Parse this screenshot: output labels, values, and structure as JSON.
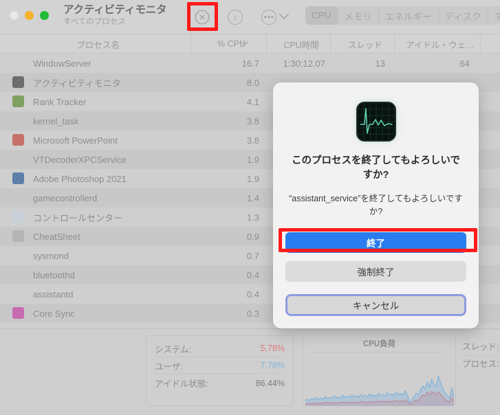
{
  "window": {
    "title": "アクティビティモニタ",
    "subtitle": "すべてのプロセス",
    "traffic": {
      "close": "close-button",
      "minimize": "minimize-button",
      "maximize": "maximize-button"
    }
  },
  "toolbar": {
    "quit_process_icon": "quit-process-octagon-icon",
    "info_icon": "info-circle-icon",
    "more_icon": "ellipsis-circle-icon",
    "chevron_icon": "chevron-down-icon",
    "highlight_color": "#ff1a1a",
    "tabs": [
      {
        "label": "CPU",
        "active": true
      },
      {
        "label": "メモリ",
        "active": false
      },
      {
        "label": "エネルギー",
        "active": false
      },
      {
        "label": "ディスク",
        "active": false
      },
      {
        "label": "ネッ",
        "active": false
      }
    ]
  },
  "table": {
    "columns": [
      {
        "label": "プロセス名"
      },
      {
        "label": "% CPU",
        "sort": "descending",
        "sort_icon": "chevron-down-icon"
      },
      {
        "label": "CPU時間"
      },
      {
        "label": "スレッド"
      },
      {
        "label": "アイドル・ウェ…"
      }
    ],
    "rows": [
      {
        "name": "WindowServer",
        "cpu": "16.7",
        "time": "1:30:12.07",
        "threads": "13",
        "idle": "64",
        "icon": ""
      },
      {
        "name": "アクティビティモニタ",
        "cpu": "8.0",
        "time": "",
        "threads": "",
        "idle": "",
        "icon": "#6d6d6d"
      },
      {
        "name": "Rank Tracker",
        "cpu": "4.1",
        "time": "",
        "threads": "",
        "idle": "",
        "icon": "#7fa05f"
      },
      {
        "name": "kernel_task",
        "cpu": "3.8",
        "time": "",
        "threads": "",
        "idle": "",
        "icon": ""
      },
      {
        "name": "Microsoft PowerPoint",
        "cpu": "3.8",
        "time": "",
        "threads": "",
        "idle": "",
        "icon": "#c8706a"
      },
      {
        "name": "VTDecoderXPCService",
        "cpu": "1.9",
        "time": "",
        "threads": "",
        "idle": "",
        "icon": ""
      },
      {
        "name": "Adobe Photoshop 2021",
        "cpu": "1.9",
        "time": "",
        "threads": "",
        "idle": "",
        "icon": "#5b7fa8"
      },
      {
        "name": "gamecontrollerd",
        "cpu": "1.4",
        "time": "",
        "threads": "",
        "idle": "",
        "icon": ""
      },
      {
        "name": "コントロールセンター",
        "cpu": "1.3",
        "time": "",
        "threads": "",
        "idle": "",
        "icon": "#c9cfd8"
      },
      {
        "name": "CheatSheet",
        "cpu": "0.9",
        "time": "",
        "threads": "",
        "idle": "",
        "icon": "#b4b4b4"
      },
      {
        "name": "sysmond",
        "cpu": "0.7",
        "time": "",
        "threads": "",
        "idle": "",
        "icon": ""
      },
      {
        "name": "bluetoothd",
        "cpu": "0.4",
        "time": "",
        "threads": "",
        "idle": "",
        "icon": ""
      },
      {
        "name": "assistantd",
        "cpu": "0.4",
        "time": "",
        "threads": "",
        "idle": "",
        "icon": ""
      },
      {
        "name": "Core Sync",
        "cpu": "0.3",
        "time": "",
        "threads": "",
        "idle": "",
        "icon": "#c86ab0"
      }
    ]
  },
  "footer": {
    "stats": [
      {
        "label": "システム:",
        "value": "5.78%",
        "color": "#e0787a"
      },
      {
        "label": "ユーザ:",
        "value": "7.78%",
        "color": "#7fb3dd"
      },
      {
        "label": "アイドル状態:",
        "value": "86.44%",
        "color": "#7d7d7d"
      }
    ],
    "graph_title": "CPU負荷",
    "right_labels": [
      {
        "label": "スレッド:"
      },
      {
        "label": "プロセス:"
      }
    ]
  },
  "dialog": {
    "app_icon": "activity-monitor-ekg-icon",
    "title": "このプロセスを終了してもよろしいですか?",
    "message": "“assistant_service”を終了してもよろしいですか?",
    "buttons": [
      {
        "label": "終了",
        "style": "primary",
        "highlighted": true
      },
      {
        "label": "強制終了",
        "style": "secondary",
        "highlighted": false
      },
      {
        "label": "キャンセル",
        "style": "focused",
        "highlighted": false
      }
    ]
  },
  "chart_data": {
    "type": "area",
    "title": "CPU負荷",
    "xlabel": "",
    "ylabel": "",
    "ylim": [
      0,
      100
    ],
    "series": [
      {
        "name": "ユーザ",
        "color": "#7fb3dd",
        "values": [
          12,
          16,
          13,
          18,
          14,
          20,
          15,
          18,
          16,
          22,
          17,
          20,
          18,
          24,
          19,
          21,
          18,
          25,
          20,
          23,
          19,
          26,
          21,
          24,
          20,
          27,
          22,
          25,
          21,
          28,
          23,
          26,
          22,
          30,
          24,
          27,
          23,
          31,
          25,
          28,
          24,
          33,
          26,
          29,
          25,
          35,
          27,
          8,
          14,
          22,
          30,
          26,
          38,
          46,
          40,
          55,
          44,
          62,
          50,
          45,
          70,
          52,
          40,
          30,
          24,
          18,
          42,
          20
        ]
      },
      {
        "name": "システム",
        "color": "#e0787a",
        "values": [
          4,
          6,
          5,
          7,
          5,
          8,
          6,
          7,
          6,
          9,
          7,
          8,
          6,
          9,
          7,
          8,
          7,
          10,
          8,
          9,
          7,
          10,
          8,
          9,
          8,
          11,
          9,
          10,
          8,
          11,
          9,
          10,
          9,
          12,
          10,
          11,
          9,
          12,
          10,
          11,
          10,
          13,
          11,
          12,
          10,
          14,
          12,
          4,
          7,
          11,
          14,
          13,
          20,
          26,
          23,
          32,
          27,
          34,
          30,
          28,
          33,
          27,
          22,
          16,
          12,
          9,
          20,
          10
        ]
      }
    ]
  }
}
